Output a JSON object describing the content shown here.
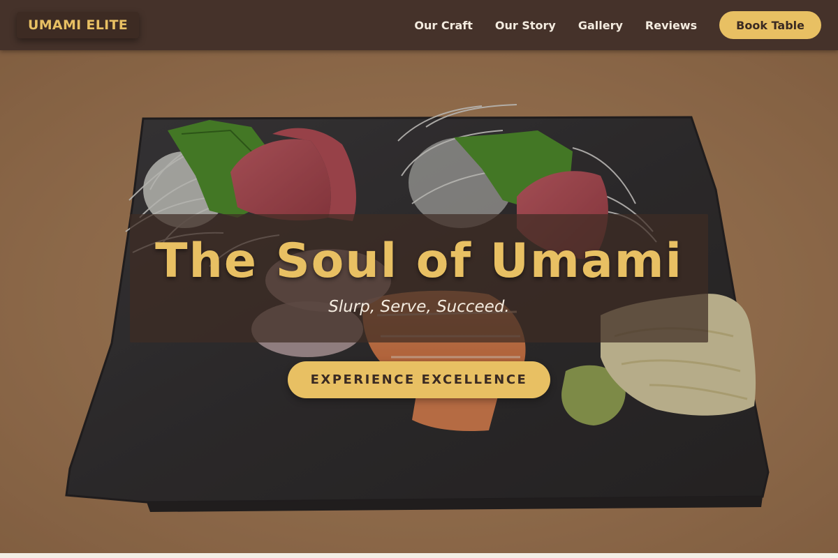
{
  "brand": {
    "name": "UMAMI ELITE"
  },
  "nav": {
    "links": [
      "Our Craft",
      "Our Story",
      "Gallery",
      "Reviews"
    ],
    "book_label": "Book Table"
  },
  "hero": {
    "title": "The Soul of Umami",
    "subtitle": "Slurp, Serve, Succeed.",
    "cta_label": "EXPERIENCE EXCELLENCE",
    "image_description_icon": "sashimi-platter-photo"
  },
  "colors": {
    "header_bg": "#45322a",
    "accent_gold": "#e8c063",
    "light_text": "#f4ece0",
    "dark_text": "#3a2a22"
  }
}
